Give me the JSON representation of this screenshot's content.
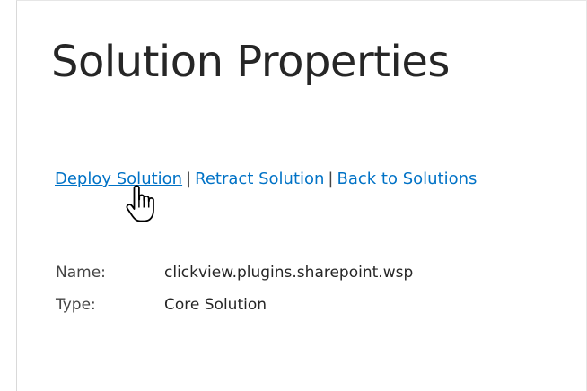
{
  "page": {
    "title": "Solution Properties"
  },
  "actions": {
    "deploy": "Deploy Solution",
    "separator_1": "|",
    "retract": "Retract Solution",
    "separator_2": "|",
    "back": "Back to Solutions"
  },
  "properties": [
    {
      "label": "Name:",
      "value": "clickview.plugins.sharepoint.wsp"
    },
    {
      "label": "Type:",
      "value": "Core Solution"
    }
  ],
  "cursor": {
    "icon": "hand-pointer-icon"
  },
  "colors": {
    "link": "#0072c6",
    "title": "#262626",
    "text": "#444444"
  }
}
